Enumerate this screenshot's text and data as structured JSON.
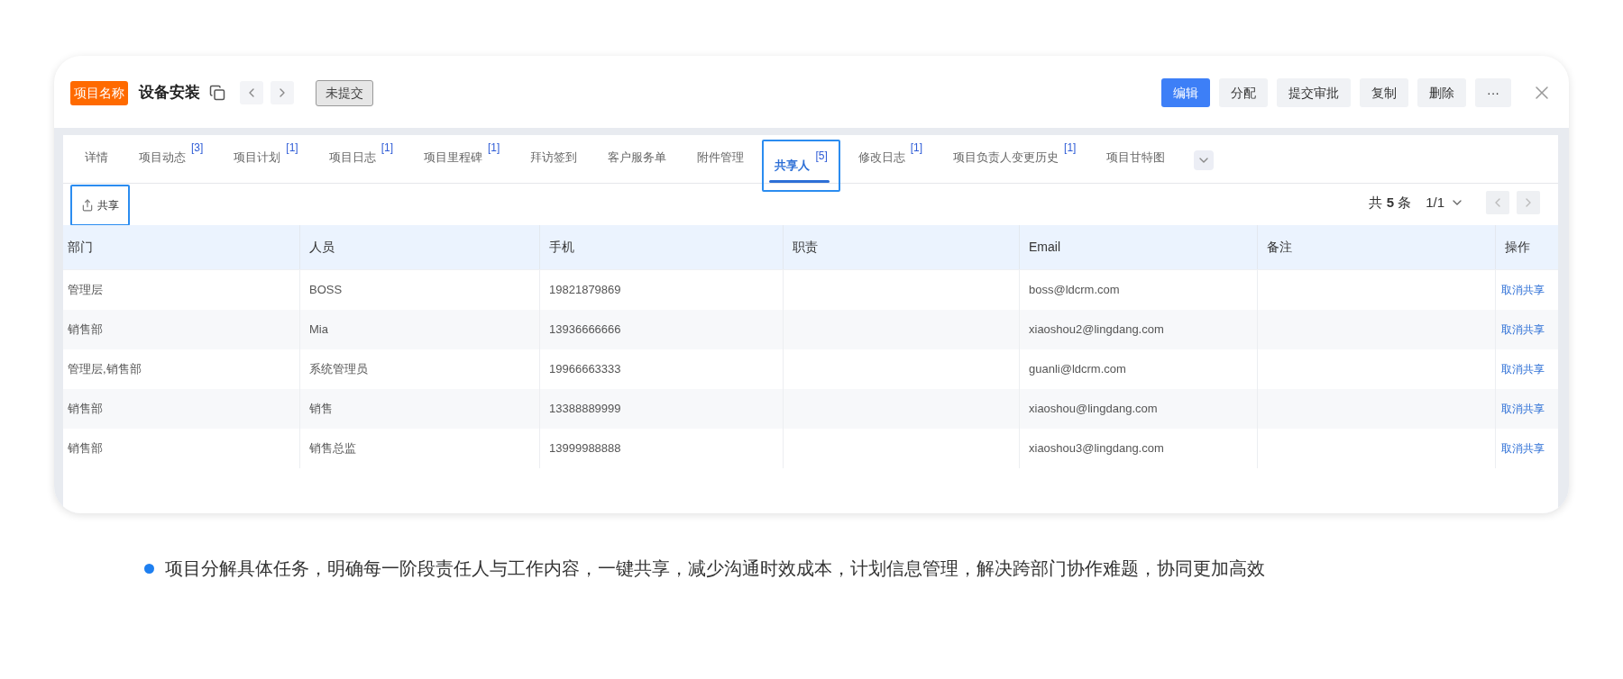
{
  "header": {
    "badge": "项目名称",
    "title": "设备安装",
    "status": "未提交",
    "actions": [
      {
        "label": "编辑",
        "kind": "primary"
      },
      {
        "label": "分配",
        "kind": "default"
      },
      {
        "label": "提交审批",
        "kind": "default"
      },
      {
        "label": "复制",
        "kind": "default"
      },
      {
        "label": "删除",
        "kind": "default"
      },
      {
        "label": "···",
        "kind": "default"
      }
    ]
  },
  "tabs": [
    {
      "label": "详情",
      "selected": false
    },
    {
      "label": "项目动态",
      "count": "[3]",
      "selected": false
    },
    {
      "label": "项目计划",
      "count": "[1]",
      "selected": false
    },
    {
      "label": "项目日志",
      "count": "[1]",
      "selected": false
    },
    {
      "label": "项目里程碑",
      "count": "[1]",
      "selected": false
    },
    {
      "label": "拜访签到",
      "selected": false
    },
    {
      "label": "客户服务单",
      "selected": false
    },
    {
      "label": "附件管理",
      "selected": false
    },
    {
      "label": "共享人",
      "count": "[5]",
      "selected": true
    },
    {
      "label": "修改日志",
      "count": "[1]",
      "selected": false
    },
    {
      "label": "项目负责人变更历史",
      "count": "[1]",
      "selected": false
    },
    {
      "label": "项目甘特图",
      "selected": false
    }
  ],
  "toolbar": {
    "share_button": "共享",
    "total": "共 **5** 条",
    "page": "1/1"
  },
  "table": {
    "columns": [
      "部门",
      "人员",
      "手机",
      "职责",
      "Email",
      "备注",
      "操作"
    ],
    "rows": [
      {
        "cells": [
          "管理层",
          "BOSS",
          "19821879869",
          "",
          "boss@ldcrm.com",
          ""
        ],
        "action": "取消共享"
      },
      {
        "cells": [
          "销售部",
          "Mia",
          "13936666666",
          "",
          "xiaoshou2@lingdang.com",
          ""
        ],
        "action": "取消共享"
      },
      {
        "cells": [
          "管理层,销售部",
          "系统管理员",
          "19966663333",
          "",
          "guanli@ldcrm.com",
          ""
        ],
        "action": "取消共享"
      },
      {
        "cells": [
          "销售部",
          "销售",
          "13388889999",
          "",
          "xiaoshou@lingdang.com",
          ""
        ],
        "action": "取消共享"
      },
      {
        "cells": [
          "销售部",
          "销售总监",
          "13999988888",
          "",
          "xiaoshou3@lingdang.com",
          ""
        ],
        "action": "取消共享"
      }
    ]
  },
  "caption": "项目分解具体任务，明确每一阶段责任人与工作内容，一键共享，减少沟通时效成本，计划信息管理，解决跨部门协作难题，协同更加高效"
}
